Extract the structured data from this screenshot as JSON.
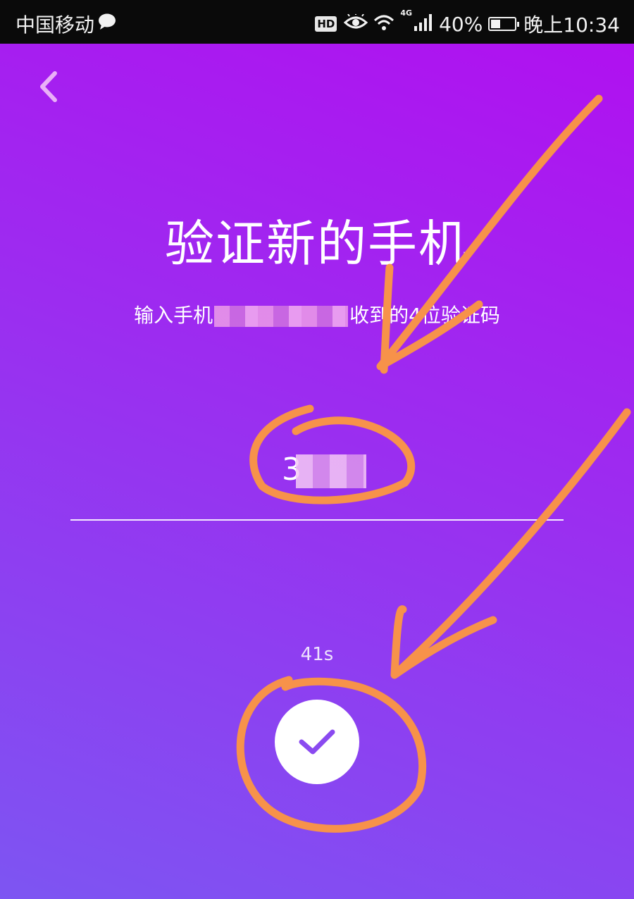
{
  "status_bar": {
    "carrier": "中国移动",
    "hd": "HD",
    "network": "4G",
    "battery_percent": "40%",
    "battery_level": 0.4,
    "time": "晚上10:34"
  },
  "nav": {
    "back_icon": "chevron-left-icon"
  },
  "page": {
    "title": "验证新的手机",
    "instruction_prefix": "输入手机",
    "instruction_suffix": "收到的4位验证码"
  },
  "code_field": {
    "visible_digit": "3"
  },
  "countdown": "41s",
  "confirm": {
    "icon": "checkmark-icon"
  },
  "colors": {
    "gradient_top": "#b20ef0",
    "gradient_bottom": "#7d55f2",
    "accent": "#8a4af0",
    "annotation": "#f7924a"
  }
}
